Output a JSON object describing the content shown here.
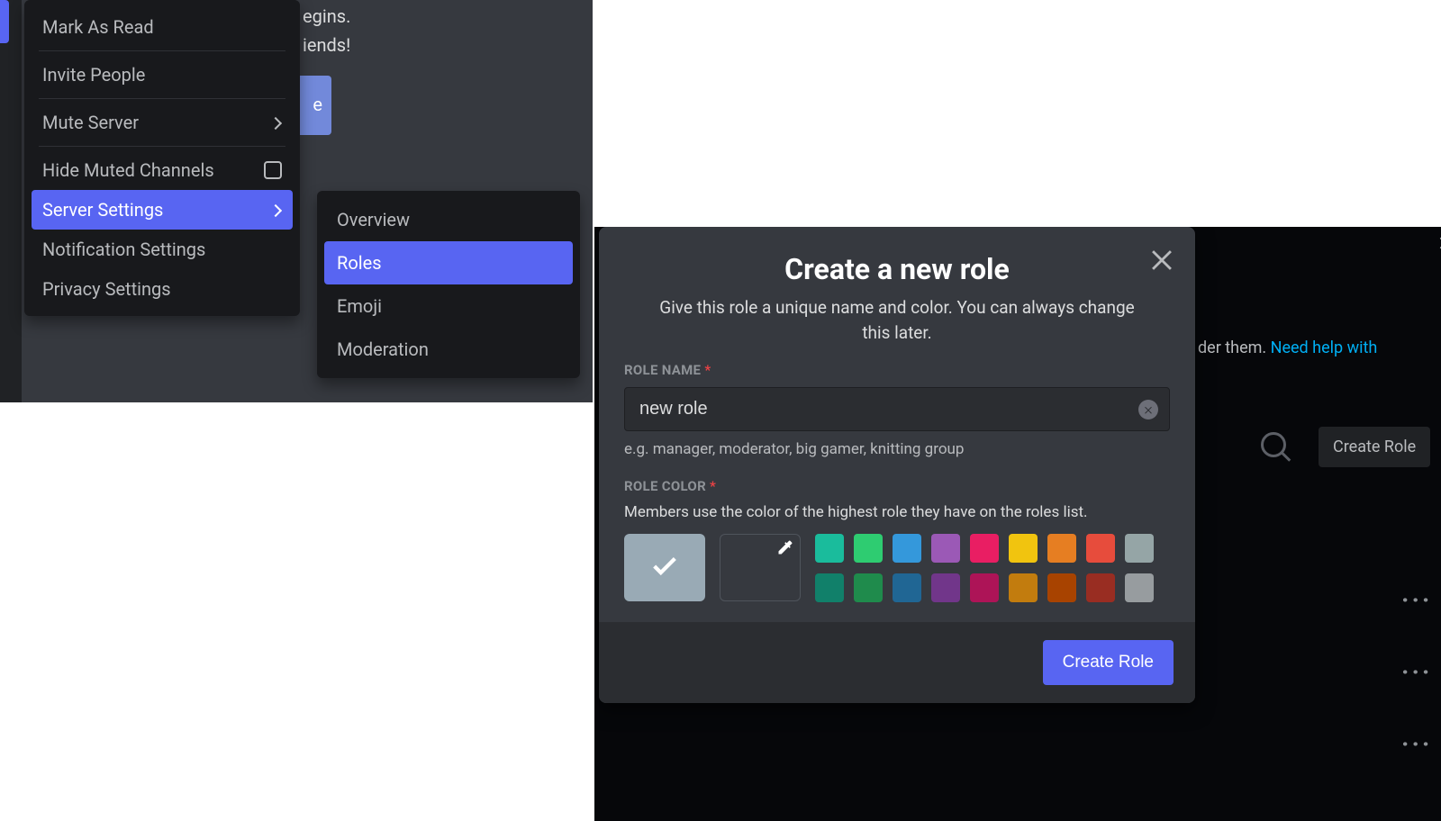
{
  "bg_left": {
    "line1_suffix": "egins.",
    "line2_suffix": "iends!",
    "button_suffix": "e"
  },
  "context_menu": {
    "mark_as_read": "Mark As Read",
    "invite_people": "Invite People",
    "mute_server": "Mute Server",
    "hide_muted": "Hide Muted Channels",
    "server_settings": "Server Settings",
    "notification_settings": "Notification Settings",
    "privacy_settings": "Privacy Settings"
  },
  "submenu": {
    "overview": "Overview",
    "roles": "Roles",
    "emoji": "Emoji",
    "moderation": "Moderation"
  },
  "bg_right": {
    "hint_suffix": "der them. ",
    "help_link": "Need help with",
    "create_role_bg": "Create Role"
  },
  "modal": {
    "title": "Create a new role",
    "subtitle": "Give this role a unique name and color. You can always change this later.",
    "role_name_label": "Role Name",
    "role_name_value": "new role",
    "role_name_hint": "e.g. manager, moderator, big gamer, knitting group",
    "role_color_label": "Role Color",
    "role_color_hint": "Members use the color of the highest role they have on the roles list.",
    "create_btn": "Create Role",
    "required": "*",
    "colors_row1": [
      "#1abc9c",
      "#2ecc71",
      "#3498db",
      "#9b59b6",
      "#e91e63",
      "#f1c40f",
      "#e67e22",
      "#e74c3c",
      "#95a5a6"
    ],
    "colors_row2": [
      "#11806a",
      "#1f8b4c",
      "#206694",
      "#71368a",
      "#ad1457",
      "#c27c0e",
      "#a84300",
      "#992d22",
      "#979c9f"
    ]
  }
}
